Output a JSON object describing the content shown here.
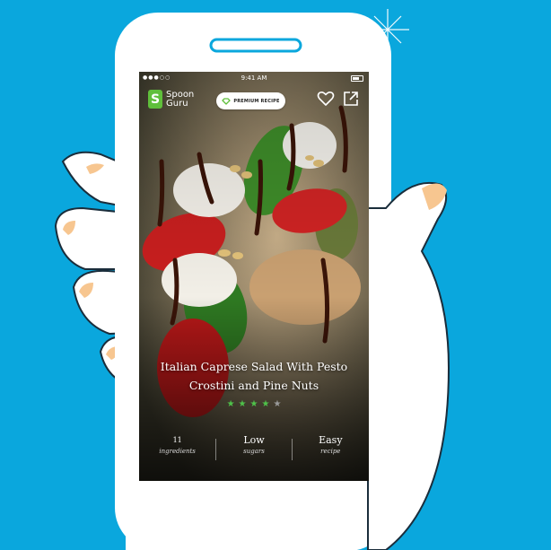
{
  "status_bar": {
    "signal": "●●●○○",
    "time": "9:41 AM"
  },
  "brand": {
    "mark": "S",
    "line1": "Spoon",
    "line2": "Guru"
  },
  "badge": {
    "label": "PREMIUM RECIPE"
  },
  "recipe": {
    "title_line1": "Italian Caprese Salad With Pesto",
    "title_line2": "Crostini and Pine Nuts",
    "rating": 4,
    "rating_max": 5
  },
  "stats": [
    {
      "value": "11",
      "label": "ingredients"
    },
    {
      "value": "Low",
      "label": "sugars"
    },
    {
      "value": "Easy",
      "label": "recipe"
    }
  ],
  "colors": {
    "background": "#0aa7dd",
    "brand": "#5fbf3b",
    "star": "#4fc24a",
    "skin": "#f7c690"
  }
}
